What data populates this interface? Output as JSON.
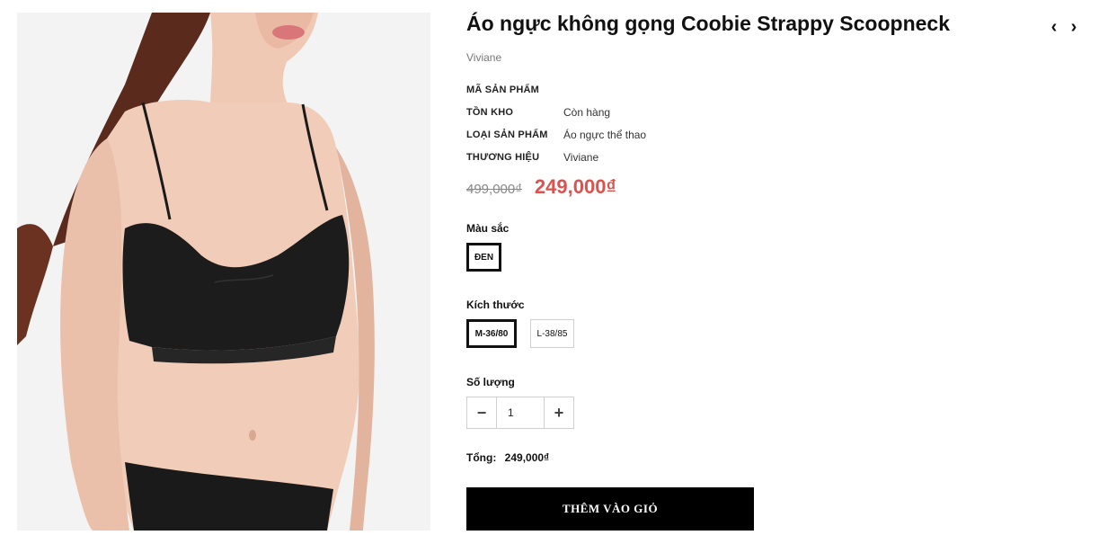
{
  "product": {
    "title": "Áo ngực không gọng Coobie Strappy Scoopneck",
    "brand_link": "Viviane",
    "meta": [
      {
        "label": "MÃ SẢN PHẨM",
        "value": ""
      },
      {
        "label": "TỒN KHO",
        "value": "Còn hàng"
      },
      {
        "label": "LOẠI SẢN PHẨM",
        "value": "Áo ngực thể thao"
      },
      {
        "label": "THƯƠNG HIỆU",
        "value": "Viviane"
      }
    ],
    "price_old": "499,000₫",
    "price_new": "249,000₫",
    "price_color": "#d9534f"
  },
  "options": {
    "color_label": "Màu sắc",
    "colors": [
      {
        "label": "ĐEN",
        "selected": true
      }
    ],
    "size_label": "Kích thước",
    "sizes": [
      {
        "label": "M-36/80",
        "selected": true
      },
      {
        "label": "L-38/85",
        "selected": false
      }
    ]
  },
  "quantity": {
    "label": "Số lượng",
    "value": "1",
    "minus_icon": "minus-icon",
    "plus_icon": "plus-icon"
  },
  "total": {
    "label": "Tổng:",
    "value": "249,000₫"
  },
  "cart": {
    "add_label": "THÊM VÀO GIỎ",
    "button_color": "#000000"
  },
  "nav": {
    "prev_icon": "chevron-left-icon",
    "next_icon": "chevron-right-icon"
  },
  "image": {
    "alt_icon": "product-photo"
  }
}
